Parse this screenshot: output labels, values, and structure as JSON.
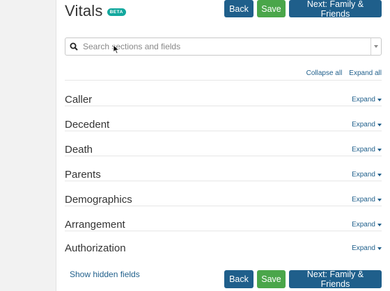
{
  "header": {
    "title": "Vitals",
    "badge": "BETA",
    "back_label": "Back",
    "save_label": "Save",
    "next_label": "Next: Family & Friends"
  },
  "search": {
    "placeholder": "Search sections and fields",
    "value": ""
  },
  "toolbar": {
    "collapse_all": "Collapse all",
    "expand_all": "Expand all"
  },
  "sections": [
    {
      "title": "Caller",
      "action": "Expand"
    },
    {
      "title": "Decedent",
      "action": "Expand"
    },
    {
      "title": "Death",
      "action": "Expand"
    },
    {
      "title": "Parents",
      "action": "Expand"
    },
    {
      "title": "Demographics",
      "action": "Expand"
    },
    {
      "title": "Arrangement",
      "action": "Expand"
    },
    {
      "title": "Authorization",
      "action": "Expand"
    }
  ],
  "footer": {
    "show_hidden": "Show hidden fields",
    "back_label": "Back",
    "save_label": "Save",
    "next_label": "Next: Family & Friends"
  },
  "colors": {
    "primary_blue": "#1f5f8b",
    "save_green": "#4aa64a",
    "beta_teal": "#13a89e"
  }
}
